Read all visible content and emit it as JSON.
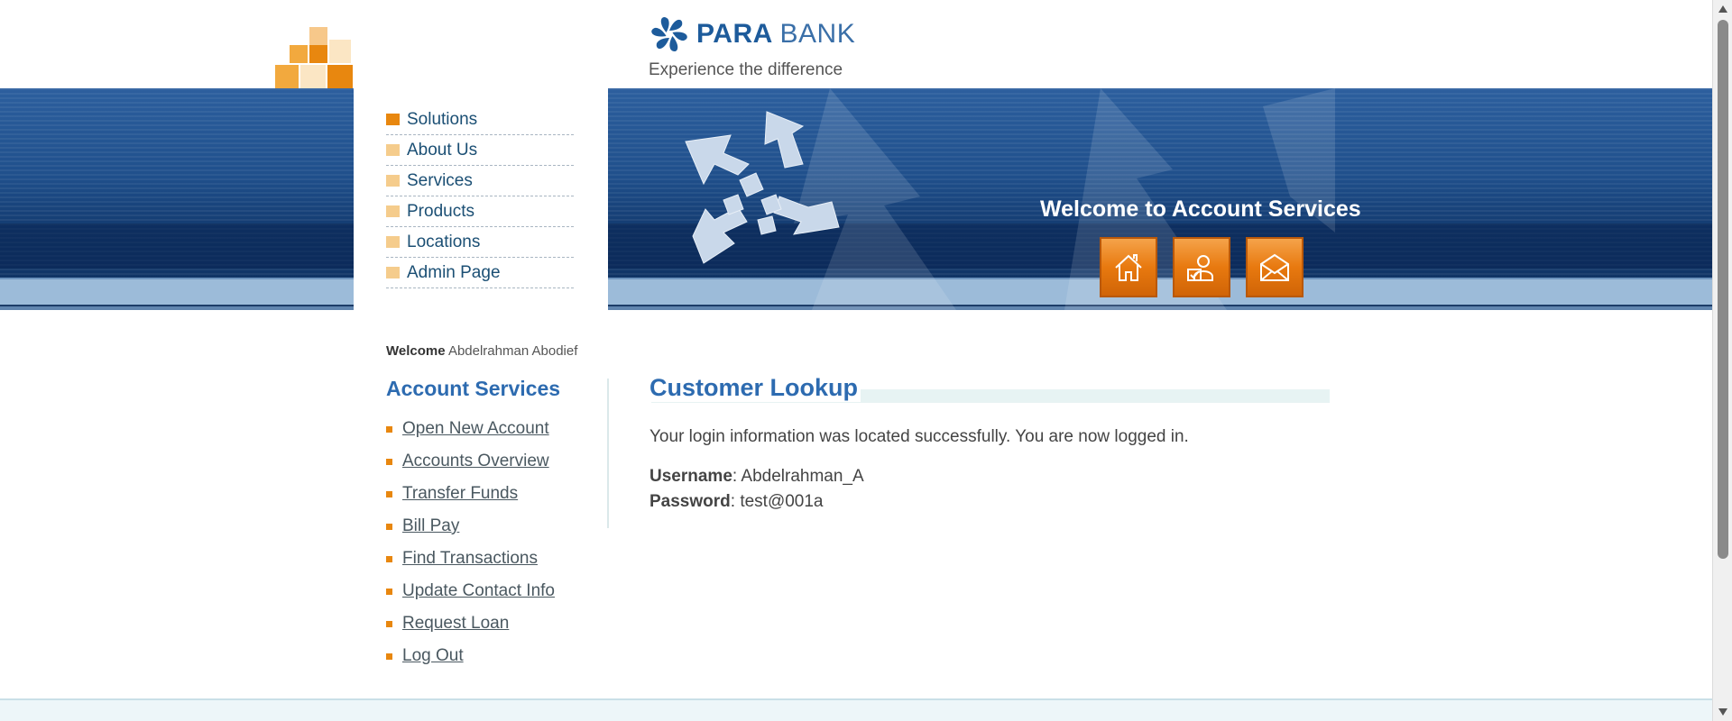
{
  "brand": {
    "name_bold": "PARA",
    "name_light": "BANK",
    "tagline": "Experience the difference"
  },
  "nav": {
    "items": [
      {
        "label": "Solutions"
      },
      {
        "label": "About Us"
      },
      {
        "label": "Services"
      },
      {
        "label": "Products"
      },
      {
        "label": "Locations"
      },
      {
        "label": "Admin Page"
      }
    ]
  },
  "banner": {
    "title": "Welcome to Account Services",
    "buttons": [
      "home-icon",
      "contact-icon",
      "mail-icon"
    ]
  },
  "sidebar": {
    "welcome_label": "Welcome",
    "welcome_user": "Abdelrahman Abodief",
    "heading": "Account Services",
    "links": [
      {
        "label": "Open New Account"
      },
      {
        "label": "Accounts Overview"
      },
      {
        "label": "Transfer Funds"
      },
      {
        "label": "Bill Pay"
      },
      {
        "label": "Find Transactions"
      },
      {
        "label": "Update Contact Info"
      },
      {
        "label": "Request Loan"
      },
      {
        "label": "Log Out"
      }
    ]
  },
  "main": {
    "title": "Customer Lookup",
    "message": "Your login information was located successfully. You are now logged in.",
    "username_label": "Username",
    "username_value": ": Abdelrahman_A",
    "password_label": "Password",
    "password_value": ": test@001a"
  },
  "colors": {
    "brand_blue": "#2d6bb0",
    "accent_orange": "#e8870f",
    "banner_blue": "#1f4f8b"
  }
}
